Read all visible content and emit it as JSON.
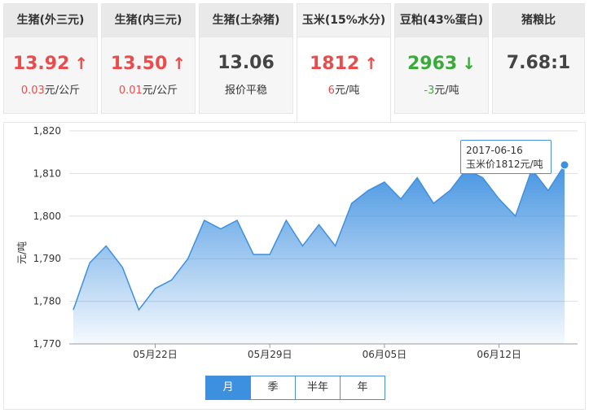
{
  "tabs": [
    {
      "name": "生猪(外三元)",
      "value": "13.92",
      "change": "0.03",
      "unit": "元/公斤",
      "trend": "up",
      "arrow": "↑"
    },
    {
      "name": "生猪(内三元)",
      "value": "13.50",
      "change": "0.01",
      "unit": "元/公斤",
      "trend": "up",
      "arrow": "↑"
    },
    {
      "name": "生猪(土杂猪)",
      "value": "13.06",
      "note": "报价平稳",
      "trend": "flat"
    },
    {
      "name": "玉米(15%水分)",
      "value": "1812",
      "change": "6",
      "unit": "元/吨",
      "trend": "up",
      "arrow": "↑"
    },
    {
      "name": "豆粕(43%蛋白)",
      "value": "2963",
      "change": "-3",
      "unit": "元/吨",
      "trend": "down",
      "arrow": "↓"
    },
    {
      "name": "猪粮比",
      "value": "7.68:1",
      "trend": "flat"
    }
  ],
  "range_buttons": [
    "月",
    "季",
    "半年",
    "年"
  ],
  "tooltip": {
    "date": "2017-06-16",
    "label": "玉米价1812元/吨"
  },
  "colors": {
    "up": "#e84c4c",
    "down": "#3aaa3a",
    "accent": "#3d8fe0"
  },
  "chart_data": {
    "type": "area",
    "x": [
      "2017-05-17",
      "2017-05-18",
      "2017-05-19",
      "2017-05-20",
      "2017-05-21",
      "2017-05-22",
      "2017-05-23",
      "2017-05-24",
      "2017-05-25",
      "2017-05-26",
      "2017-05-27",
      "2017-05-28",
      "2017-05-29",
      "2017-05-30",
      "2017-05-31",
      "2017-06-01",
      "2017-06-02",
      "2017-06-03",
      "2017-06-04",
      "2017-06-05",
      "2017-06-06",
      "2017-06-07",
      "2017-06-08",
      "2017-06-09",
      "2017-06-10",
      "2017-06-11",
      "2017-06-12",
      "2017-06-13",
      "2017-06-14",
      "2017-06-15",
      "2017-06-16"
    ],
    "values": [
      1778,
      1789,
      1793,
      1788,
      1778,
      1783,
      1785,
      1790,
      1799,
      1797,
      1799,
      1791,
      1791,
      1799,
      1793,
      1798,
      1793,
      1803,
      1806,
      1808,
      1804,
      1809,
      1803,
      1806,
      1811,
      1809,
      1804,
      1800,
      1811,
      1806,
      1812
    ],
    "ylabel": "元/吨",
    "ylim": [
      1770,
      1820
    ],
    "yticks": [
      "1,770",
      "1,780",
      "1,790",
      "1,800",
      "1,810",
      "1,820"
    ],
    "xticks": [
      {
        "date": "2017-05-22",
        "label": "05月22日"
      },
      {
        "date": "2017-05-29",
        "label": "05月29日"
      },
      {
        "date": "2017-06-05",
        "label": "06月05日"
      },
      {
        "date": "2017-06-12",
        "label": "06月12日"
      }
    ],
    "grid": true,
    "color": "#3d8fe0"
  }
}
